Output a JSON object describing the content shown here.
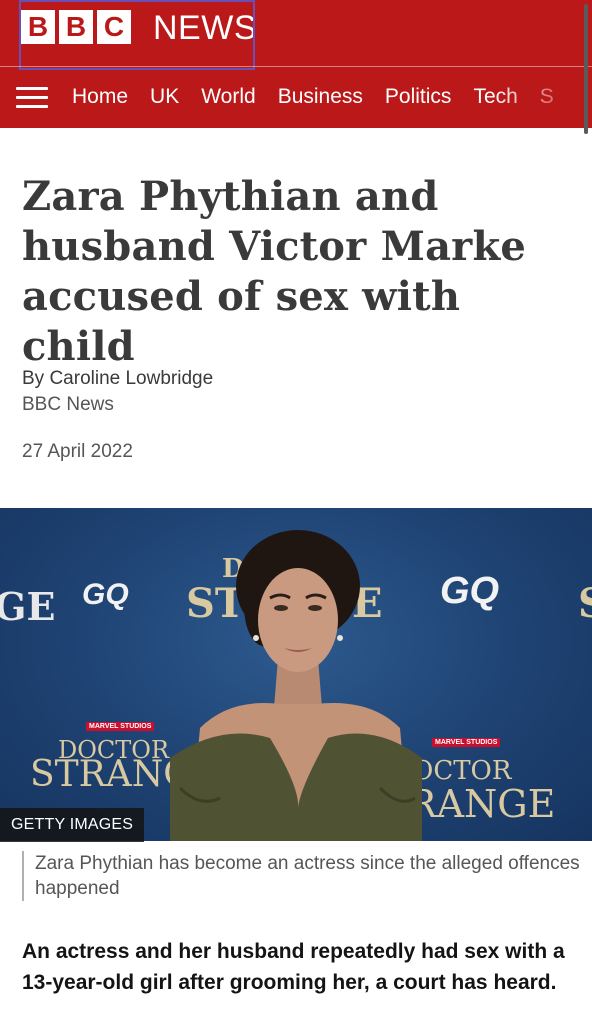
{
  "brand": {
    "blocks": [
      "B",
      "B",
      "C"
    ],
    "name": "NEWS"
  },
  "nav": {
    "items": [
      "Home",
      "UK",
      "World",
      "Business",
      "Politics",
      "Tech",
      "S"
    ]
  },
  "article": {
    "headline": "Zara Phythian and husband Victor Marke accused of sex with child",
    "author": "By Caroline Lowbridge",
    "organisation": "BBC News",
    "date": "27 April 2022",
    "image": {
      "credit": "GETTY IMAGES",
      "caption": "Zara Phythian has become an actress since the alleged offences happened",
      "backdrop_text": {
        "left_fragment": "GE",
        "gq_left": "GQ",
        "gq_right": "GQ",
        "strange_top": "D",
        "strange_mid": "ST",
        "strange_end": "E",
        "right_fragment": "S",
        "marvel_left": "MARVEL STUDIOS",
        "doctor_left": "DOCTOR",
        "strange_left": "STRANG",
        "marvel_right": "MARVEL STUDIOS",
        "doctor_right": "OCTOR",
        "strange_right": "RANGE"
      }
    },
    "intro": "An actress and her husband repeatedly had sex with a 13-year-old girl after grooming her, a court has heard."
  },
  "colors": {
    "brand_red": "#bb1919",
    "backdrop_blue": "#1e4272",
    "focus_outline": "#6b4fb8"
  },
  "icons": {
    "menu": "hamburger-menu-icon"
  }
}
